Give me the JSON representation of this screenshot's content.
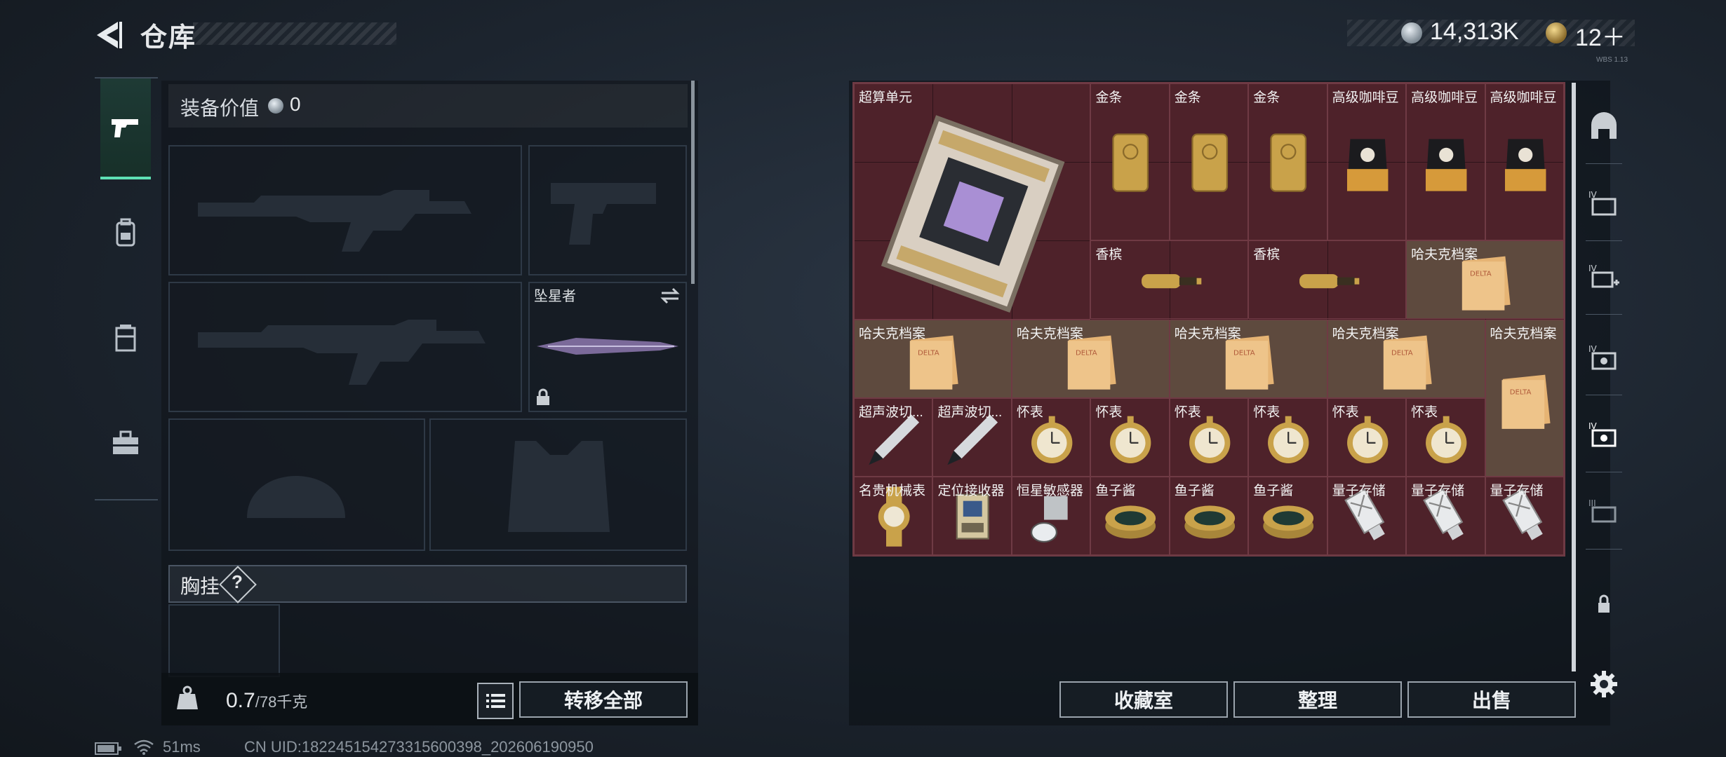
{
  "header": {
    "title": "仓库",
    "silver_amount": "14,313K",
    "gold_amount": "12＋",
    "tiny_label": "WBS 1.13"
  },
  "left_tabs": [
    {
      "icon": "pistol-icon",
      "active": true
    },
    {
      "icon": "backpack-icon",
      "active": false
    },
    {
      "icon": "chest-rig-icon",
      "active": false
    },
    {
      "icon": "toolbox-icon",
      "active": false
    }
  ],
  "loadout": {
    "value_label": "装备价值",
    "value_amount": "0",
    "melee_slot_label": "坠星者",
    "chest_rig_label": "胸挂",
    "help_symbol": "?",
    "weight_value": "0.7",
    "weight_max": "/78千克",
    "transfer_all": "转移全部"
  },
  "storage": {
    "items": [
      {
        "name": "超算单元",
        "icon": "supercomputer-chip"
      },
      {
        "name": "金条",
        "icon": "gold-bar"
      },
      {
        "name": "金条",
        "icon": "gold-bar"
      },
      {
        "name": "金条",
        "icon": "gold-bar"
      },
      {
        "name": "高级咖啡豆",
        "icon": "coffee-bag"
      },
      {
        "name": "高级咖啡豆",
        "icon": "coffee-bag"
      },
      {
        "name": "高级咖啡豆",
        "icon": "coffee-bag"
      },
      {
        "name": "香槟",
        "icon": "champagne"
      },
      {
        "name": "香槟",
        "icon": "champagne"
      },
      {
        "name": "哈夫克档案",
        "icon": "dossier"
      },
      {
        "name": "哈夫克档案",
        "icon": "dossier"
      },
      {
        "name": "哈夫克档案",
        "icon": "dossier"
      },
      {
        "name": "哈夫克档案",
        "icon": "dossier"
      },
      {
        "name": "哈夫克档案",
        "icon": "dossier"
      },
      {
        "name": "哈夫克档案",
        "icon": "dossier"
      },
      {
        "name": "超声波切...",
        "icon": "ultrasonic-cutter"
      },
      {
        "name": "超声波切...",
        "icon": "ultrasonic-cutter"
      },
      {
        "name": "怀表",
        "icon": "pocket-watch"
      },
      {
        "name": "怀表",
        "icon": "pocket-watch"
      },
      {
        "name": "怀表",
        "icon": "pocket-watch"
      },
      {
        "name": "怀表",
        "icon": "pocket-watch"
      },
      {
        "name": "怀表",
        "icon": "pocket-watch"
      },
      {
        "name": "怀表",
        "icon": "pocket-watch"
      },
      {
        "name": "名贵机械表",
        "icon": "luxury-watch"
      },
      {
        "name": "定位接收器",
        "icon": "locator-receiver"
      },
      {
        "name": "恒星敏感器",
        "icon": "star-sensor"
      },
      {
        "name": "鱼子酱",
        "icon": "caviar-tin"
      },
      {
        "name": "鱼子酱",
        "icon": "caviar-tin"
      },
      {
        "name": "鱼子酱",
        "icon": "caviar-tin"
      },
      {
        "name": "量子存储",
        "icon": "quantum-drive"
      },
      {
        "name": "量子存储",
        "icon": "quantum-drive"
      },
      {
        "name": "量子存储",
        "icon": "quantum-drive"
      }
    ],
    "buttons": {
      "collection": "收藏室",
      "organize": "整理",
      "sell": "出售"
    }
  },
  "side_icons": [
    "storage-arch-icon",
    "storage-iv-a-icon",
    "storage-iv-b-icon",
    "storage-iv-c-icon",
    "storage-iv-d-icon",
    "storage-iii-icon",
    "lock-icon"
  ],
  "status_bar": {
    "ping": "51ms",
    "uid": "CN UID:182245154273315600398_202606190950"
  },
  "colors": {
    "accent": "#5ee0b4",
    "grid_bg": "#4e222a",
    "gold": "#c9a24a"
  }
}
